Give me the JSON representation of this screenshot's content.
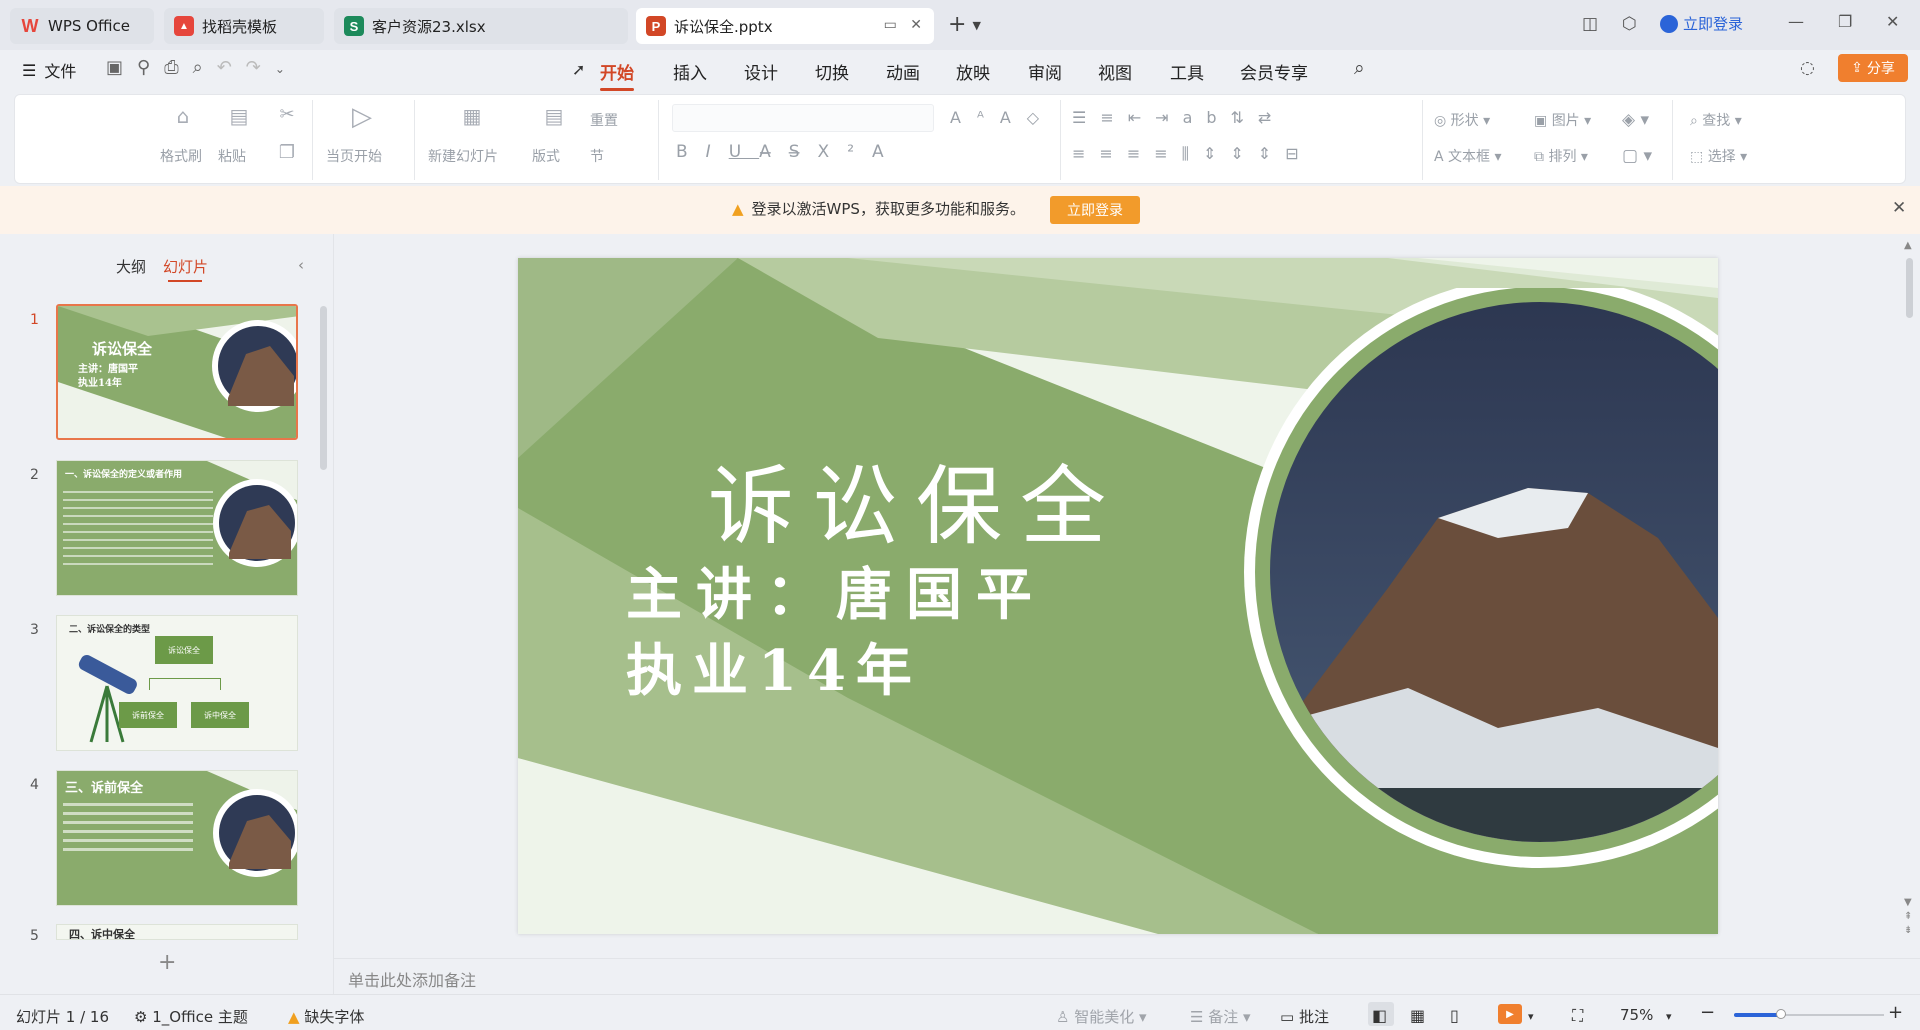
{
  "tabs": [
    {
      "label": "WPS Office",
      "logo": "W",
      "color": "#e6463c"
    },
    {
      "label": "找稻壳模板",
      "logo": "稻",
      "color": "#e6463c"
    },
    {
      "label": "客户资源23.xlsx",
      "logo": "S",
      "color": "#1d8a5b"
    },
    {
      "label": "诉讼保全.pptx",
      "logo": "P",
      "color": "#d24726"
    }
  ],
  "titlebar": {
    "login": "立即登录",
    "add_tab": "+"
  },
  "menu": {
    "file": "文件",
    "items": [
      "开始",
      "插入",
      "设计",
      "切换",
      "动画",
      "放映",
      "审阅",
      "视图",
      "工具",
      "会员专享"
    ],
    "share": "分享"
  },
  "ribbon": {
    "format_brush": "格式刷",
    "paste": "粘贴",
    "start_current": "当页开始",
    "new_slide": "新建幻灯片",
    "layout": "版式",
    "reset": "重置",
    "section": "节",
    "shape": "形状",
    "picture": "图片",
    "textbox": "文本框",
    "arrange": "排列",
    "find": "查找",
    "select": "选择"
  },
  "notice": {
    "text": "登录以激活WPS，获取更多功能和服务。",
    "button": "立即登录"
  },
  "panel": {
    "outline": "大纲",
    "slides": "幻灯片"
  },
  "thumbnails": [
    {
      "num": "1",
      "title": "诉讼保全",
      "lines": [
        "主讲：唐国平",
        "执业14年"
      ]
    },
    {
      "num": "2",
      "title": "一、诉讼保全的定义或者作用"
    },
    {
      "num": "3",
      "title": "二、诉讼保全的类型",
      "boxes": [
        "诉讼保全",
        "诉前保全",
        "诉中保全"
      ]
    },
    {
      "num": "4",
      "title": "三、诉前保全"
    },
    {
      "num": "5",
      "title": "四、诉中保全"
    }
  ],
  "slide": {
    "title": "诉讼保全",
    "speaker": "主讲：唐国平",
    "experience": "执业14年"
  },
  "notes_placeholder": "单击此处添加备注",
  "status": {
    "slide_count": "幻灯片 1 / 16",
    "theme": "1_Office 主题",
    "missing_font": "缺失字体",
    "smart_beautify": "智能美化",
    "notes": "备注",
    "comments": "批注",
    "zoom": "75%"
  },
  "colors": {
    "accent": "#d24726",
    "green": "#8aab6c",
    "login_btn": "#f29b2b"
  }
}
